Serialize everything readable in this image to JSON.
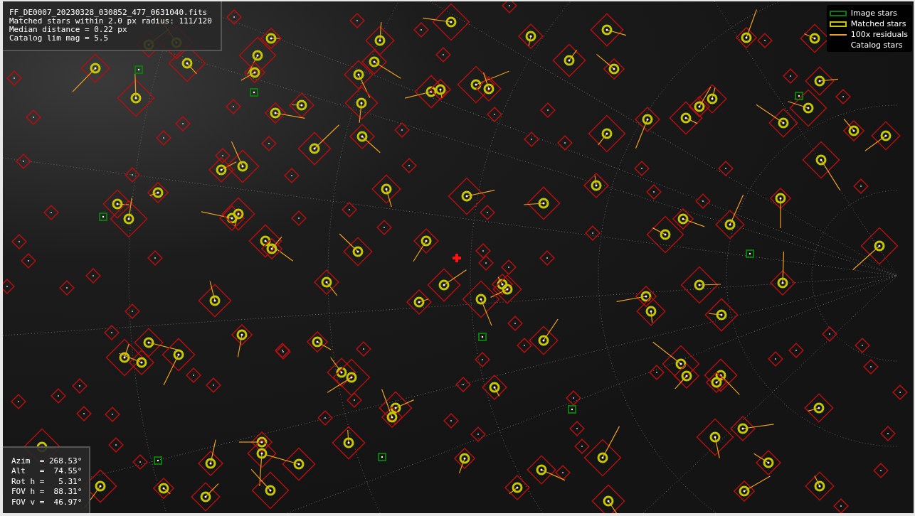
{
  "info_box": {
    "lines": [
      "FF_DE0007_20230328_030852_477_0631040.fits",
      "Matched stars within 2.0 px radius: 111/120",
      "Median distance = 0.22 px",
      "Catalog lim mag = 5.5"
    ]
  },
  "orientation_box": {
    "lines": [
      "Azim  = 268.53°",
      "Alt   =  74.55°",
      "Rot h =   5.31°",
      "FOV h =  88.31°",
      "FOV v =  46.97°"
    ]
  },
  "legend": {
    "items": [
      {
        "label": "Image stars",
        "kind": "box",
        "color": "#0a7a0a"
      },
      {
        "label": "Matched stars",
        "kind": "box",
        "color": "#c8c800"
      },
      {
        "label": "100x residuals",
        "kind": "line",
        "color": "#f0a020"
      },
      {
        "label": "Catalog stars",
        "kind": "none"
      }
    ]
  }
}
